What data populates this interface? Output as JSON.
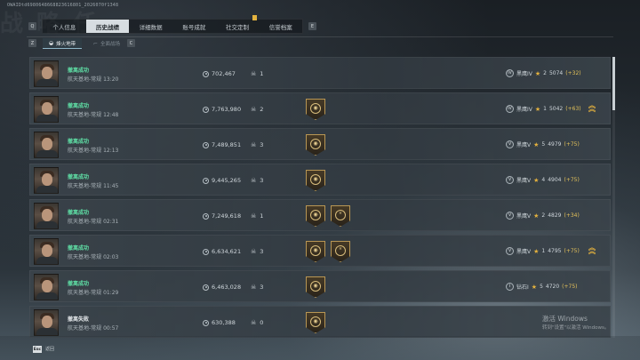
{
  "uid_text": "OWAIDtd6980648668823616801_2026070f1348",
  "bg_deco_text": "战 略 任",
  "top_tabs": {
    "key_left": "Q",
    "key_right": "E",
    "items": [
      {
        "label": "个人信息"
      },
      {
        "label": "历史战绩"
      },
      {
        "label": "详细数据"
      },
      {
        "label": "账号成就"
      },
      {
        "label": "社交定制"
      },
      {
        "label": "信誉档案"
      }
    ],
    "active_index": 1
  },
  "sub_tabs": {
    "key_left": "Z",
    "key_right": "C",
    "items": [
      {
        "label": "烽火地带",
        "icon": "helmet-icon"
      },
      {
        "label": "全面战场",
        "icon": "gun-icon"
      }
    ],
    "active_index": 0
  },
  "matches": [
    {
      "result": "撤离成功",
      "map_time": "航天基地-常规 13:20",
      "value": "702,467",
      "kills": "1",
      "badges": [],
      "rank_icon": "IV",
      "rank": "黑鹰IV",
      "stars": "2",
      "score": "5074",
      "delta": "(+32)",
      "chevrons": false
    },
    {
      "result": "撤离成功",
      "map_time": "航天基地-常规 12:48",
      "value": "7,763,980",
      "kills": "2",
      "badges": [
        "medal"
      ],
      "rank_icon": "IV",
      "rank": "黑鹰IV",
      "stars": "1",
      "score": "5042",
      "delta": "(+63)",
      "chevrons": true
    },
    {
      "result": "撤离成功",
      "map_time": "航天基地-常规 12:13",
      "value": "7,489,851",
      "kills": "3",
      "badges": [
        "medal"
      ],
      "rank_icon": "V",
      "rank": "黑鹰V",
      "stars": "5",
      "score": "4979",
      "delta": "(+75)",
      "chevrons": false
    },
    {
      "result": "撤离成功",
      "map_time": "航天基地-常规 11:45",
      "value": "9,445,265",
      "kills": "3",
      "badges": [
        "medal"
      ],
      "rank_icon": "V",
      "rank": "黑鹰V",
      "stars": "4",
      "score": "4904",
      "delta": "(+75)",
      "chevrons": false
    },
    {
      "result": "撤离成功",
      "map_time": "航天基地-常规 02:31",
      "value": "7,249,618",
      "kills": "1",
      "badges": [
        "medal",
        "snake"
      ],
      "rank_icon": "V",
      "rank": "黑鹰V",
      "stars": "2",
      "score": "4829",
      "delta": "(+34)",
      "chevrons": false
    },
    {
      "result": "撤离成功",
      "map_time": "航天基地-常规 02:03",
      "value": "6,634,621",
      "kills": "3",
      "badges": [
        "medal",
        "snake"
      ],
      "rank_icon": "V",
      "rank": "黑鹰V",
      "stars": "1",
      "score": "4795",
      "delta": "(+75)",
      "chevrons": true
    },
    {
      "result": "撤离成功",
      "map_time": "航天基地-常规 01:29",
      "value": "6,463,028",
      "kills": "3",
      "badges": [
        "medal"
      ],
      "rank_icon": "I",
      "rank": "钻石I",
      "stars": "5",
      "score": "4720",
      "delta": "(+75)",
      "chevrons": false
    },
    {
      "result": "撤离失败",
      "map_time": "航天基地-常规 00:57",
      "value": "630,388",
      "kills": "0",
      "badges": [
        "medal"
      ],
      "rank_icon": "",
      "rank": "",
      "stars": "",
      "score": "",
      "delta": "",
      "chevrons": false
    }
  ],
  "footer": {
    "esc_key": "Esc",
    "back_label": "返回"
  },
  "watermark": {
    "title": "激活 Windows",
    "subtitle": "转到\"设置\"以激活 Windows。"
  },
  "colors": {
    "success": "#5fe0a6",
    "accent_gold": "#e3b13e",
    "tab_active_bg": "#d7dde1"
  }
}
